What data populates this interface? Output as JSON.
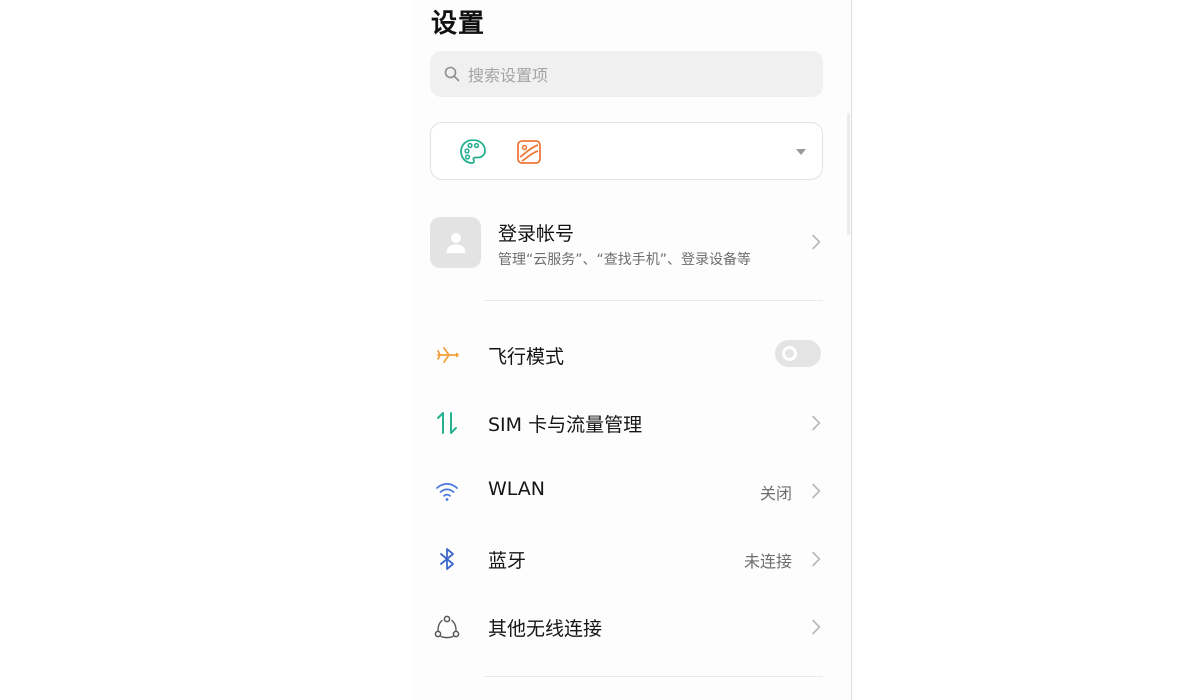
{
  "header": {
    "title": "设置"
  },
  "search": {
    "placeholder": "搜索设置项",
    "icon": "search-icon"
  },
  "theme_card": {
    "icons": [
      "palette-icon",
      "wallpaper-icon"
    ],
    "dropdown_icon": "triangle-down-icon",
    "colors": {
      "palette": "#27b08f",
      "wallpaper": "#ee7a3a"
    }
  },
  "account": {
    "title": "登录帐号",
    "subtitle": "管理“云服务”、“查找手机”、登录设备等",
    "icon": "person-icon"
  },
  "settings": [
    {
      "label": "飞行模式",
      "icon": "airplane-icon",
      "control": "toggle",
      "toggle_on": false,
      "color": "#f0a13b"
    },
    {
      "label": "SIM 卡与流量管理",
      "icon": "sim-data-icon",
      "control": "chevron",
      "color": "#27b08f"
    },
    {
      "label": "WLAN",
      "icon": "wifi-icon",
      "value": "关闭",
      "control": "chevron",
      "color": "#4b78e0"
    },
    {
      "label": "蓝牙",
      "icon": "bluetooth-icon",
      "value": "未连接",
      "control": "chevron",
      "color": "#3d67c9"
    },
    {
      "label": "其他无线连接",
      "icon": "wireless-connections-icon",
      "control": "chevron",
      "color": "#555555"
    }
  ]
}
